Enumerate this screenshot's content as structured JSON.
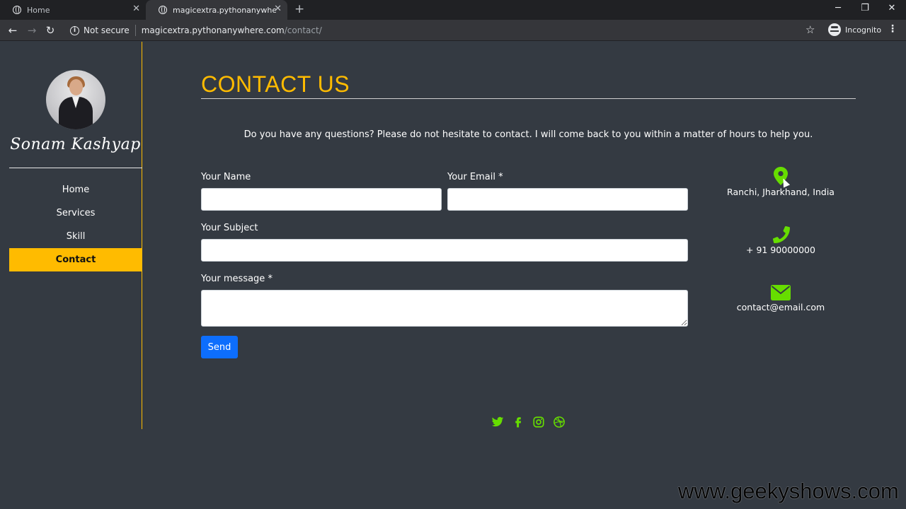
{
  "browser": {
    "tabs": [
      {
        "title": "Home"
      },
      {
        "title": "magicextra.pythonanywhere.com"
      }
    ],
    "security": "Not secure",
    "url_host": "magicextra.pythonanywhere.com",
    "url_path": "/contact/",
    "incognito_label": "Incognito"
  },
  "sidebar": {
    "name": "Sonam Kashyap",
    "items": [
      {
        "label": "Home"
      },
      {
        "label": "Services"
      },
      {
        "label": "Skill"
      },
      {
        "label": "Contact",
        "active": true
      }
    ]
  },
  "main": {
    "title": "CONTACT US",
    "intro": "Do you have any questions? Please do not hesitate to contact. I will come back to you within a matter of hours to help you.",
    "form": {
      "name_label": "Your Name",
      "email_label": "Your Email *",
      "subject_label": "Your Subject",
      "message_label": "Your message *",
      "name_value": "",
      "email_value": "",
      "subject_value": "",
      "message_value": "",
      "send_label": "Send"
    },
    "contact": {
      "address": "Ranchi, Jharkhand, India",
      "phone": "+ 91 90000000",
      "email": "contact@email.com"
    },
    "social_icons": [
      "twitter-icon",
      "facebook-icon",
      "instagram-icon",
      "dribbble-icon"
    ]
  },
  "colors": {
    "accent": "#ffbb00",
    "icon_green": "#66dd00",
    "button_blue": "#0d6efd",
    "background": "#343a42"
  },
  "watermark": "www.geekyshows.com"
}
